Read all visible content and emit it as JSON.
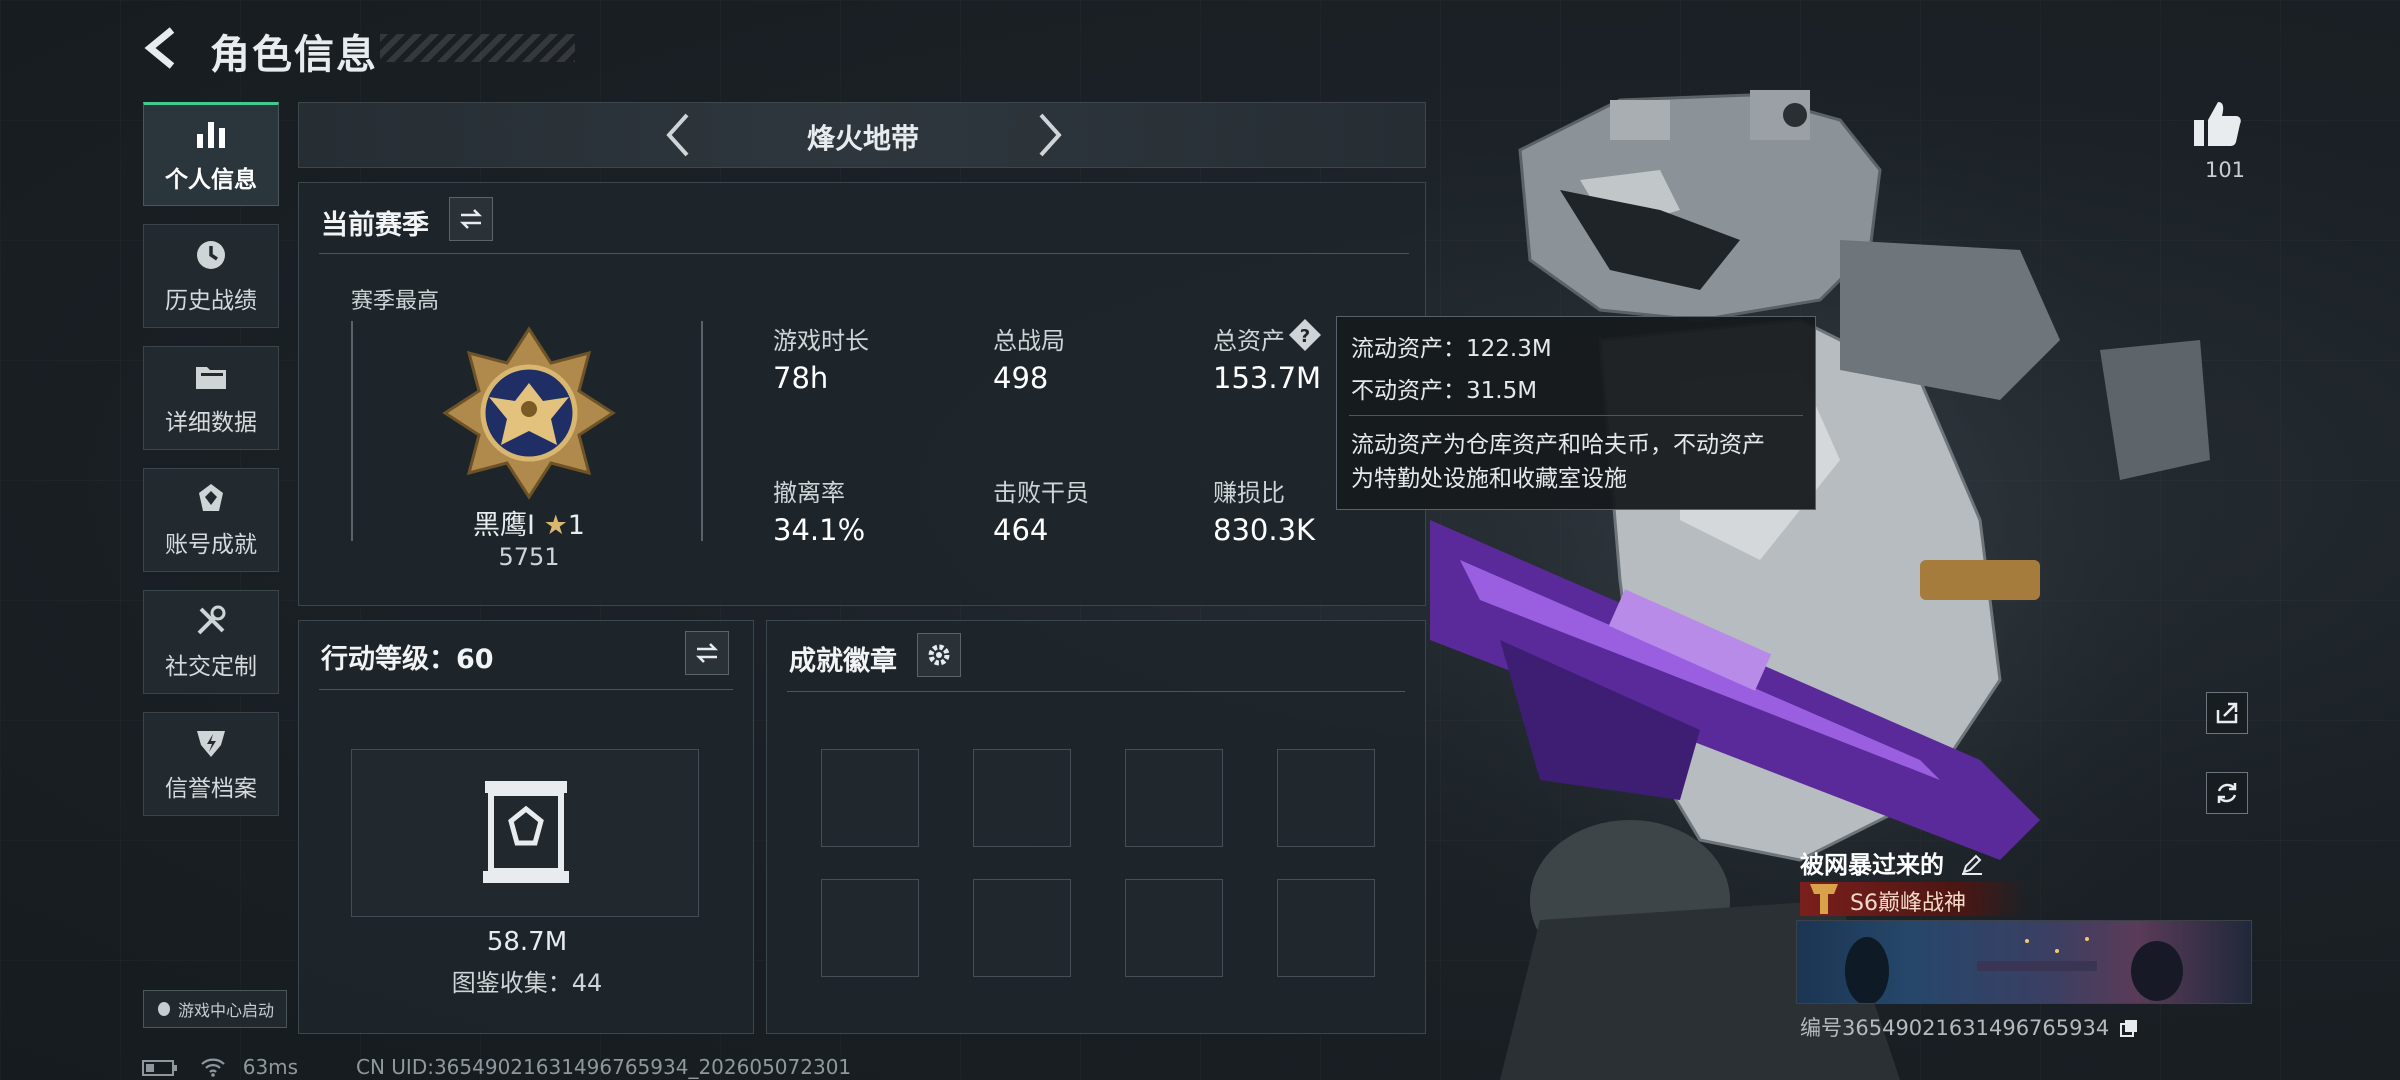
{
  "header": {
    "title": "角色信息"
  },
  "sidebar": {
    "items": [
      {
        "label": "个人信息",
        "icon": "bar-chart-icon",
        "active": true
      },
      {
        "label": "历史战绩",
        "icon": "history-clock-icon"
      },
      {
        "label": "详细数据",
        "icon": "folder-icon"
      },
      {
        "label": "账号成就",
        "icon": "achievement-icon"
      },
      {
        "label": "社交定制",
        "icon": "tools-icon"
      },
      {
        "label": "信誉档案",
        "icon": "reputation-icon"
      }
    ],
    "game_center": "游戏中心启动"
  },
  "mode": {
    "title": "烽火地带"
  },
  "season": {
    "title": "当前赛季",
    "best_label": "赛季最高",
    "rank_name": "黑鹰",
    "rank_tier": "I",
    "rank_stars": "1",
    "rank_points": "5751",
    "stats": [
      {
        "label": "游戏时长",
        "value": "78h"
      },
      {
        "label": "总战局",
        "value": "498"
      },
      {
        "label": "总资产",
        "value": "153.7M"
      },
      {
        "label": "撤离率",
        "value": "34.1%"
      },
      {
        "label": "击败干员",
        "value": "464"
      },
      {
        "label": "赚损比",
        "value": "830.3K"
      }
    ]
  },
  "tooltip": {
    "liquid": "流动资产：122.3M",
    "fixed": "不动资产：31.5M",
    "desc_1": "流动资产为仓库资产和哈夫币，不动资产",
    "desc_2": "为特勤处设施和收藏室设施"
  },
  "action_level": {
    "title": "行动等级：60",
    "collection_value": "58.7M",
    "collection_label": "图鉴收集：44"
  },
  "badges": {
    "title": "成就徽章"
  },
  "player": {
    "likes": "101",
    "name": "被网暴过来的",
    "title": "S6巅峰战神",
    "serial": "编号3654902163149676593​4"
  },
  "status": {
    "ping": "63ms",
    "uid": "CN UID:36549021631496765934_202605072301"
  },
  "colors": {
    "accent": "#42c98f",
    "panel": "#1e252b",
    "tooltip_bg": "#16191e",
    "title_red": "#7b1f1c"
  }
}
